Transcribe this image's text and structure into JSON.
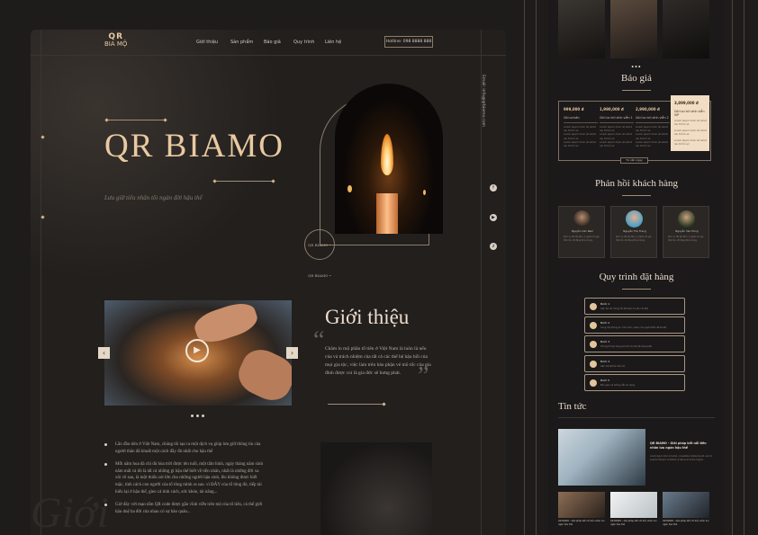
{
  "brand": {
    "logo_mark": "QR",
    "logo_text": "BIA MỘ"
  },
  "nav": {
    "links": [
      "Giới thiệu",
      "Sản phẩm",
      "Báo giá",
      "Quy trình",
      "Liên hệ"
    ],
    "hotline": "Hotline: 098 8888 888"
  },
  "hero": {
    "title": "QR BIAMO",
    "subtitle": "Lưu giữ tiêu nhân tôi ngàn đời hậu thế",
    "badge": "QR BIAMO • QR BIAMO •",
    "email": "Email: info@qrbiamo.com"
  },
  "social": {
    "icons": [
      "facebook-icon",
      "youtube-icon",
      "zalo-icon"
    ]
  },
  "intro": {
    "title": "Giới thiệu",
    "body": "Chăm lo mộ phần tổ tiên ở Việt Nam là luôn là nếu của và trách nhiệm của tất cả các thế hệ hậu bối của mọi gia tộc, việc làm trên bảo phận vé mõ tốc của gia đình được coi là gia đức sẽ hưng phát.",
    "bullets": [
      "Lần đầu tiên ở Việt Nam, chúng tôi tạo ra một dịch vụ giúp lưu giữ thông tin của người thân đã khuất một cách đầy đủ nhất cho hậu thế",
      "Mỗi năm hoa đà chỉ đủ hòa trời được tên tuổi, một tấm hình, ngày tháng năm sinh năm mất và đó là tất cả những gì hậu thế biết về tiền nhân, nhất là những đời xa xôi về sau, là một thiếu sót lớn cho những người hậu sinh, lẽo không được biết mặc, tính cách con người của tổ tông mình ra sao. vì ĐÂY của tổ tông đó, tiếp tài hiếu lại ở hậu thế, gieo cả tính cách, sức khỏe, tài năng...",
      "Giờ đây với mạn tấm QR code được gắn vĩnh viễn trên mộ của tổ tiên, cả thế giới hậu duệ ba đời của nhau có sự bảo quản..."
    ],
    "ghost": "Giới"
  },
  "pricing": {
    "title": "Báo giá",
    "plans": [
      {
        "price": "999,000 đ",
        "name": "Gói cơ bản"
      },
      {
        "price": "1,990,000 đ",
        "name": "Gói lưu trữ vĩnh viễn 1"
      },
      {
        "price": "2,990,000 đ",
        "name": "Gói lưu trữ vĩnh viễn 2"
      },
      {
        "price": "3,899,000 đ",
        "name": "Gói lưu trữ vĩnh viễn VIP"
      }
    ],
    "feature_text": "Lorem ipsum dolor sit amet lưu trữ hồ sơ",
    "button": "Tư vấn ngay"
  },
  "feedback": {
    "title": "Phản hồi khách hàng",
    "people": [
      {
        "name": "Nguyễn Văn Nam",
        "text": "Dịch vụ rất tận tâm, ý nghĩa cho gia đình tôi, rất đáng để sử dụng."
      },
      {
        "name": "Nguyễn Thu Trang",
        "text": "Dịch vụ rất tận tâm, ý nghĩa cho gia đình tôi, rất đáng để sử dụng."
      },
      {
        "name": "Nguyễn Văn Hùng",
        "text": "Dịch vụ rất tận tâm, ý nghĩa cho gia đình tôi, rất đáng để sử dụng."
      }
    ]
  },
  "process": {
    "title": "Quy trình đặt hàng",
    "steps": [
      {
        "title": "Bước 1",
        "desc": "Liên hệ với chúng tôi để được tư vấn chi tiết"
      },
      {
        "title": "Bước 2",
        "desc": "Cung cấp thông tin, hình ảnh, video của người thân đã khuất"
      },
      {
        "title": "Bước 3",
        "desc": "Chúng tôi tạo trang lưu trữ và mã QR riêng biệt"
      },
      {
        "title": "Bước 4",
        "desc": "Gắn mã QR lên bia mộ"
      },
      {
        "title": "Bước 5",
        "desc": "Bàn giao và hướng dẫn sử dụng"
      }
    ]
  },
  "news": {
    "title": "Tin tức",
    "featured_title": "QR BIAMO - Giải pháp kết nối tiền nhân lưu ngàn hậu thế",
    "featured_desc": "Lorem ipsum dolor sit amet, consectetur adipiscing elit, sed do eiusmod tempor incididunt ut labore et dolore magna.",
    "items": [
      "QR BIAMO - Giải pháp kết nối tiền nhân lưu ngàn hậu thế",
      "QR BIAMO - Giải pháp kết nối tiền nhân lưu ngàn hậu thế",
      "QR BIAMO - Giải pháp kết nối tiền nhân lưu ngàn hậu thế"
    ]
  },
  "colors": {
    "accent": "#e9c9a2",
    "bg": "#221f1d",
    "highlight": "#f0ddc3"
  }
}
